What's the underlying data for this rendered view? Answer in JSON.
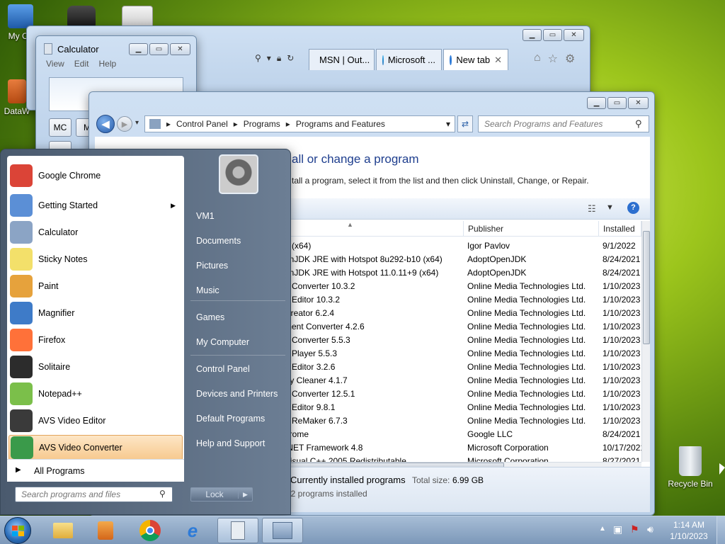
{
  "desktop": {
    "icons": [
      {
        "label": "My Co"
      },
      {
        "label": "DataW"
      },
      {
        "label": "Recycle Bin"
      }
    ]
  },
  "browser": {
    "tabs": [
      {
        "label": "MSN | Out..."
      },
      {
        "label": "Microsoft ..."
      },
      {
        "label": "New tab"
      }
    ],
    "close_tab": "✕"
  },
  "calculator": {
    "title": "Calculator",
    "menu": [
      "View",
      "Edit",
      "Help"
    ],
    "keys": [
      "MC",
      "M"
    ]
  },
  "programs_window": {
    "breadcrumb": [
      "Control Panel",
      "Programs",
      "Programs and Features"
    ],
    "search_placeholder": "Search Programs and Features",
    "heading": "all or change a program",
    "subtext": "tall a program, select it from the list and then click Uninstall, Change, or Repair.",
    "columns": {
      "name": "",
      "publisher": "Publisher",
      "installed": "Installed"
    },
    "programs": [
      {
        "name": "1 (x64)",
        "publisher": "Igor Pavlov",
        "installed": "9/1/2022"
      },
      {
        "name": "enJDK JRE with Hotspot 8u292-b10 (x64)",
        "publisher": "AdoptOpenJDK",
        "installed": "8/24/2021"
      },
      {
        "name": "enJDK JRE with Hotspot 11.0.11+9 (x64)",
        "publisher": "AdoptOpenJDK",
        "installed": "8/24/2021"
      },
      {
        "name": "o Converter 10.3.2",
        "publisher": "Online Media Technologies Ltd.",
        "installed": "1/10/2023"
      },
      {
        "name": "o Editor 10.3.2",
        "publisher": "Online Media Technologies Ltd.",
        "installed": "1/10/2023"
      },
      {
        "name": "Creator 6.2.4",
        "publisher": "Online Media Technologies Ltd.",
        "installed": "1/10/2023"
      },
      {
        "name": "ment Converter 4.2.6",
        "publisher": "Online Media Technologies Ltd.",
        "installed": "1/10/2023"
      },
      {
        "name": "e Converter 5.5.3",
        "publisher": "Online Media Technologies Ltd.",
        "installed": "1/10/2023"
      },
      {
        "name": "a Player 5.5.3",
        "publisher": "Online Media Technologies Ltd.",
        "installed": "1/10/2023"
      },
      {
        "name": "o Editor 3.2.6",
        "publisher": "Online Media Technologies Ltd.",
        "installed": "1/10/2023"
      },
      {
        "name": "try Cleaner 4.1.7",
        "publisher": "Online Media Technologies Ltd.",
        "installed": "1/10/2023"
      },
      {
        "name": "o Converter 12.5.1",
        "publisher": "Online Media Technologies Ltd.",
        "installed": "1/10/2023"
      },
      {
        "name": "o Editor 9.8.1",
        "publisher": "Online Media Technologies Ltd.",
        "installed": "1/10/2023"
      },
      {
        "name": "o ReMaker 6.7.3",
        "publisher": "Online Media Technologies Ltd.",
        "installed": "1/10/2023"
      },
      {
        "name": "hrome",
        "publisher": "Google LLC",
        "installed": "8/24/2021"
      },
      {
        "name": ".NET Framework 4.8",
        "publisher": "Microsoft Corporation",
        "installed": "10/17/2021"
      },
      {
        "name": "Visual C++ 2005 Redistributable",
        "publisher": "Microsoft Corporation",
        "installed": "8/27/2021"
      }
    ],
    "status": {
      "label": "Currently installed programs",
      "total_size_label": "Total size:",
      "total_size": "6.99 GB",
      "count": "32 programs installed"
    }
  },
  "start_menu": {
    "pinned": [
      {
        "label": "Google Chrome",
        "icon": "chrome-icon",
        "color": "#db4437"
      },
      {
        "label": "Getting Started",
        "icon": "getting-started-icon",
        "color": "#5b8fd6"
      },
      {
        "label": "Calculator",
        "icon": "calculator-icon",
        "color": "#8ba4c5"
      },
      {
        "label": "Sticky Notes",
        "icon": "sticky-notes-icon",
        "color": "#f3e06a"
      },
      {
        "label": "Paint",
        "icon": "paint-icon",
        "color": "#e6a23c"
      },
      {
        "label": "Magnifier",
        "icon": "magnifier-icon",
        "color": "#3e7bc8"
      },
      {
        "label": "Firefox",
        "icon": "firefox-icon",
        "color": "#ff7139"
      },
      {
        "label": "Solitaire",
        "icon": "solitaire-icon",
        "color": "#2c2c2c"
      },
      {
        "label": "Notepad++",
        "icon": "notepadpp-icon",
        "color": "#7bbf4a"
      },
      {
        "label": "AVS Video Editor",
        "icon": "video-editor-icon",
        "color": "#3a3a3a"
      },
      {
        "label": "AVS Video Converter",
        "icon": "video-converter-icon",
        "color": "#3a9a4a"
      }
    ],
    "all_programs": "All Programs",
    "search_placeholder": "Search programs and files",
    "right_items": [
      "VM1",
      "Documents",
      "Pictures",
      "Music",
      "Games",
      "My Computer",
      "Control Panel",
      "Devices and Printers",
      "Default Programs",
      "Help and Support"
    ],
    "lock_label": "Lock"
  },
  "taskbar": {
    "time": "1:14 AM",
    "date": "1/10/2023"
  }
}
